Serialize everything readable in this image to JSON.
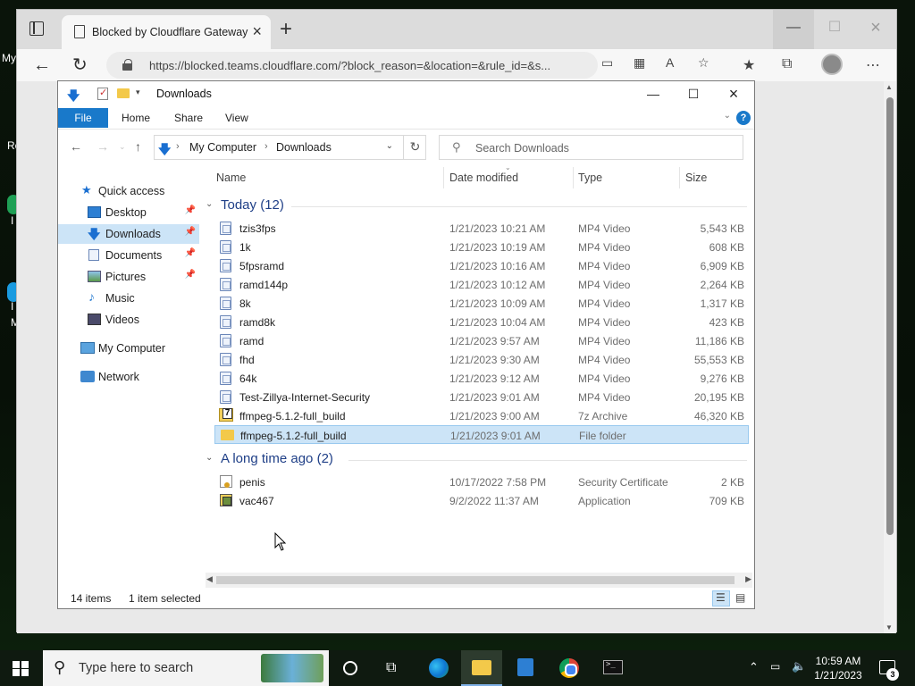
{
  "browser": {
    "tab_title": "Blocked by Cloudflare Gateway",
    "url": "https://blocked.teams.cloudflare.com/?block_reason=&location=&rule_id=&s..."
  },
  "explorer": {
    "title": "Downloads",
    "ribbon": {
      "file": "File",
      "home": "Home",
      "share": "Share",
      "view": "View"
    },
    "breadcrumb": [
      "My Computer",
      "Downloads"
    ],
    "search_placeholder": "Search Downloads",
    "nav": [
      {
        "label": "Quick access",
        "icon": "star-icon",
        "pinned": false
      },
      {
        "label": "Desktop",
        "icon": "desktop-icon",
        "pinned": true
      },
      {
        "label": "Downloads",
        "icon": "downloads-icon",
        "pinned": true,
        "selected": true
      },
      {
        "label": "Documents",
        "icon": "documents-icon",
        "pinned": true
      },
      {
        "label": "Pictures",
        "icon": "pictures-icon",
        "pinned": true
      },
      {
        "label": "Music",
        "icon": "music-icon",
        "pinned": false
      },
      {
        "label": "Videos",
        "icon": "videos-icon",
        "pinned": false
      },
      {
        "label": "My Computer",
        "icon": "computer-icon",
        "pinned": false
      },
      {
        "label": "Network",
        "icon": "network-icon",
        "pinned": false
      }
    ],
    "columns": {
      "name": "Name",
      "date": "Date modified",
      "type": "Type",
      "size": "Size"
    },
    "groups": [
      {
        "label": "Today (12)",
        "files": [
          {
            "name": "tzis3fps",
            "date": "1/21/2023 10:21 AM",
            "type": "MP4 Video",
            "size": "5,543 KB",
            "icon": "video-file-icon"
          },
          {
            "name": "1k",
            "date": "1/21/2023 10:19 AM",
            "type": "MP4 Video",
            "size": "608 KB",
            "icon": "video-file-icon"
          },
          {
            "name": "5fpsramd",
            "date": "1/21/2023 10:16 AM",
            "type": "MP4 Video",
            "size": "6,909 KB",
            "icon": "video-file-icon"
          },
          {
            "name": "ramd144p",
            "date": "1/21/2023 10:12 AM",
            "type": "MP4 Video",
            "size": "2,264 KB",
            "icon": "video-file-icon"
          },
          {
            "name": "8k",
            "date": "1/21/2023 10:09 AM",
            "type": "MP4 Video",
            "size": "1,317 KB",
            "icon": "video-file-icon"
          },
          {
            "name": "ramd8k",
            "date": "1/21/2023 10:04 AM",
            "type": "MP4 Video",
            "size": "423 KB",
            "icon": "video-file-icon"
          },
          {
            "name": "ramd",
            "date": "1/21/2023 9:57 AM",
            "type": "MP4 Video",
            "size": "11,186 KB",
            "icon": "video-file-icon"
          },
          {
            "name": "fhd",
            "date": "1/21/2023 9:30 AM",
            "type": "MP4 Video",
            "size": "55,553 KB",
            "icon": "video-file-icon"
          },
          {
            "name": "64k",
            "date": "1/21/2023 9:12 AM",
            "type": "MP4 Video",
            "size": "9,276 KB",
            "icon": "video-file-icon"
          },
          {
            "name": "Test-Zillya-Internet-Security",
            "date": "1/21/2023 9:01 AM",
            "type": "MP4 Video",
            "size": "20,195 KB",
            "icon": "video-file-icon"
          },
          {
            "name": "ffmpeg-5.1.2-full_build",
            "date": "1/21/2023 9:00 AM",
            "type": "7z Archive",
            "size": "46,320 KB",
            "icon": "archive-file-icon"
          },
          {
            "name": "ffmpeg-5.1.2-full_build",
            "date": "1/21/2023 9:01 AM",
            "type": "File folder",
            "size": "",
            "icon": "folder-icon",
            "selected": true
          }
        ]
      },
      {
        "label": "A long time ago (2)",
        "files": [
          {
            "name": "penis",
            "date": "10/17/2022 7:58 PM",
            "type": "Security Certificate",
            "size": "2 KB",
            "icon": "certificate-file-icon"
          },
          {
            "name": "vac467",
            "date": "9/2/2022 11:37 AM",
            "type": "Application",
            "size": "709 KB",
            "icon": "application-file-icon"
          }
        ]
      }
    ],
    "status": {
      "count": "14 items",
      "selected": "1 item selected"
    }
  },
  "taskbar": {
    "search_placeholder": "Type here to search",
    "time": "10:59 AM",
    "date": "1/21/2023",
    "notifications": "3"
  },
  "desktop": {
    "fragments": [
      "My",
      "Re",
      "I",
      "I",
      "M"
    ]
  }
}
